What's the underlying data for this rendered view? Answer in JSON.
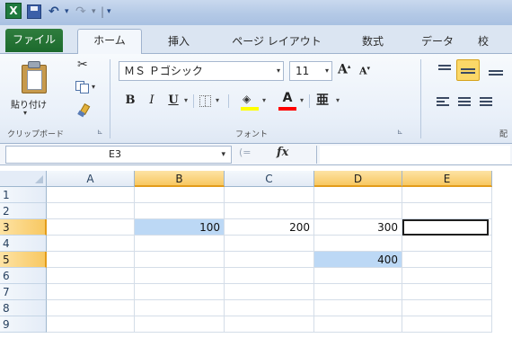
{
  "quick_access": {
    "excel_label": "X",
    "undo": "↶",
    "redo": "↷",
    "dropdown": "▾",
    "separator": "|"
  },
  "ribbon_tabs": [
    {
      "label": "ファイル"
    },
    {
      "label": "ホーム"
    },
    {
      "label": "挿入"
    },
    {
      "label": "ページ レイアウト"
    },
    {
      "label": "数式"
    },
    {
      "label": "データ"
    },
    {
      "label": "校"
    }
  ],
  "home": {
    "clipboard": {
      "paste_label": "貼り付け",
      "group_label": "クリップボード",
      "launcher": "⊾"
    },
    "font": {
      "font_name": "ＭＳ Ｐゴシック",
      "font_size": "11",
      "grow": "A",
      "shrink": "A",
      "bold": "B",
      "italic": "I",
      "underline": "U",
      "font_color_glyph": "A",
      "phonetic_glyph": "亜",
      "group_label": "フォント",
      "fill_color": "#ffff00",
      "font_color": "#ff0000",
      "launcher": "⊾"
    },
    "alignment": {
      "group_label": "配"
    }
  },
  "formula_bar": {
    "name_box": "E3",
    "fx": "fx",
    "formula": ""
  },
  "grid": {
    "columns": [
      "A",
      "B",
      "C",
      "D",
      "E"
    ],
    "rows": [
      "1",
      "2",
      "3",
      "4",
      "5",
      "6",
      "7",
      "8",
      "9"
    ],
    "cells": [
      {
        "ref": "B3",
        "value": "100"
      },
      {
        "ref": "C3",
        "value": "200"
      },
      {
        "ref": "D3",
        "value": "300"
      },
      {
        "ref": "D5",
        "value": "400"
      }
    ],
    "active_cell": "E3",
    "highlighted_cells": [
      "B3",
      "D5"
    ],
    "highlight_color": "#bcd8f5"
  }
}
